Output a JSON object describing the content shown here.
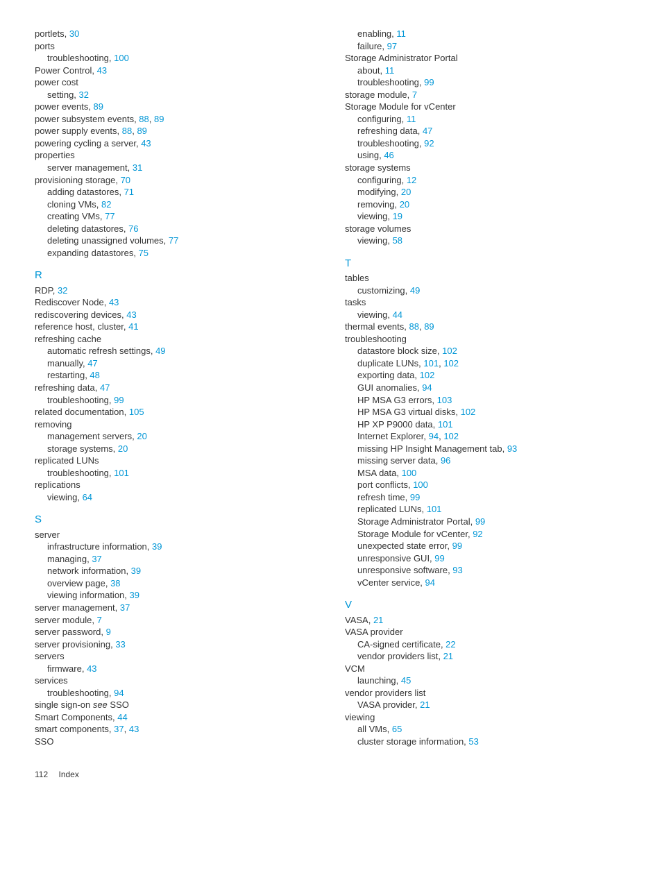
{
  "footer": {
    "pageNum": "112",
    "section": "Index"
  },
  "col1": [
    {
      "t": "line",
      "parts": [
        "portlets, ",
        {
          "p": "30"
        }
      ]
    },
    {
      "t": "line",
      "parts": [
        "ports"
      ]
    },
    {
      "t": "sub",
      "parts": [
        "troubleshooting, ",
        {
          "p": "100"
        }
      ]
    },
    {
      "t": "line",
      "parts": [
        "Power Control, ",
        {
          "p": "43"
        }
      ]
    },
    {
      "t": "line",
      "parts": [
        "power cost"
      ]
    },
    {
      "t": "sub",
      "parts": [
        "setting, ",
        {
          "p": "32"
        }
      ]
    },
    {
      "t": "line",
      "parts": [
        "power events, ",
        {
          "p": "89"
        }
      ]
    },
    {
      "t": "line",
      "parts": [
        "power subsystem events, ",
        {
          "p": "88"
        },
        ", ",
        {
          "p": "89"
        }
      ]
    },
    {
      "t": "line",
      "parts": [
        "power supply events, ",
        {
          "p": "88"
        },
        ", ",
        {
          "p": "89"
        }
      ]
    },
    {
      "t": "line",
      "parts": [
        "powering cycling a server, ",
        {
          "p": "43"
        }
      ]
    },
    {
      "t": "line",
      "parts": [
        "properties"
      ]
    },
    {
      "t": "sub",
      "parts": [
        "server management, ",
        {
          "p": "31"
        }
      ]
    },
    {
      "t": "line",
      "parts": [
        "provisioning storage, ",
        {
          "p": "70"
        }
      ]
    },
    {
      "t": "sub",
      "parts": [
        "adding datastores, ",
        {
          "p": "71"
        }
      ]
    },
    {
      "t": "sub",
      "parts": [
        "cloning VMs, ",
        {
          "p": "82"
        }
      ]
    },
    {
      "t": "sub",
      "parts": [
        "creating VMs, ",
        {
          "p": "77"
        }
      ]
    },
    {
      "t": "sub",
      "parts": [
        "deleting datastores, ",
        {
          "p": "76"
        }
      ]
    },
    {
      "t": "sub",
      "parts": [
        "deleting unassigned volumes, ",
        {
          "p": "77"
        }
      ]
    },
    {
      "t": "sub",
      "parts": [
        "expanding datastores, ",
        {
          "p": "75"
        }
      ]
    },
    {
      "t": "letter",
      "label": "R"
    },
    {
      "t": "line",
      "parts": [
        "RDP, ",
        {
          "p": "32"
        }
      ]
    },
    {
      "t": "line",
      "parts": [
        "Rediscover Node, ",
        {
          "p": "43"
        }
      ]
    },
    {
      "t": "line",
      "parts": [
        "rediscovering devices, ",
        {
          "p": "43"
        }
      ]
    },
    {
      "t": "line",
      "parts": [
        "reference host, cluster, ",
        {
          "p": "41"
        }
      ]
    },
    {
      "t": "line",
      "parts": [
        "refreshing cache"
      ]
    },
    {
      "t": "sub",
      "parts": [
        "automatic refresh settings, ",
        {
          "p": "49"
        }
      ]
    },
    {
      "t": "sub",
      "parts": [
        "manually, ",
        {
          "p": "47"
        }
      ]
    },
    {
      "t": "sub",
      "parts": [
        "restarting, ",
        {
          "p": "48"
        }
      ]
    },
    {
      "t": "line",
      "parts": [
        "refreshing data, ",
        {
          "p": "47"
        }
      ]
    },
    {
      "t": "sub",
      "parts": [
        "troubleshooting, ",
        {
          "p": "99"
        }
      ]
    },
    {
      "t": "line",
      "parts": [
        "related documentation, ",
        {
          "p": "105"
        }
      ]
    },
    {
      "t": "line",
      "parts": [
        "removing"
      ]
    },
    {
      "t": "sub",
      "parts": [
        "management servers, ",
        {
          "p": "20"
        }
      ]
    },
    {
      "t": "sub",
      "parts": [
        "storage systems, ",
        {
          "p": "20"
        }
      ]
    },
    {
      "t": "line",
      "parts": [
        "replicated LUNs"
      ]
    },
    {
      "t": "sub",
      "parts": [
        "troubleshooting, ",
        {
          "p": "101"
        }
      ]
    },
    {
      "t": "line",
      "parts": [
        "replications"
      ]
    },
    {
      "t": "sub",
      "parts": [
        "viewing, ",
        {
          "p": "64"
        }
      ]
    },
    {
      "t": "letter",
      "label": "S"
    },
    {
      "t": "line",
      "parts": [
        "server"
      ]
    },
    {
      "t": "sub",
      "parts": [
        "infrastructure information, ",
        {
          "p": "39"
        }
      ]
    },
    {
      "t": "sub",
      "parts": [
        "managing, ",
        {
          "p": "37"
        }
      ]
    },
    {
      "t": "sub",
      "parts": [
        "network information, ",
        {
          "p": "39"
        }
      ]
    },
    {
      "t": "sub",
      "parts": [
        "overview page, ",
        {
          "p": "38"
        }
      ]
    },
    {
      "t": "sub",
      "parts": [
        "viewing information, ",
        {
          "p": "39"
        }
      ]
    },
    {
      "t": "line",
      "parts": [
        "server management, ",
        {
          "p": "37"
        }
      ]
    },
    {
      "t": "line",
      "parts": [
        "server module, ",
        {
          "p": "7"
        }
      ]
    },
    {
      "t": "line",
      "parts": [
        "server password, ",
        {
          "p": "9"
        }
      ]
    },
    {
      "t": "line",
      "parts": [
        "server provisioning, ",
        {
          "p": "33"
        }
      ]
    },
    {
      "t": "line",
      "parts": [
        "servers"
      ]
    },
    {
      "t": "sub",
      "parts": [
        "firmware, ",
        {
          "p": "43"
        }
      ]
    },
    {
      "t": "line",
      "parts": [
        "services"
      ]
    },
    {
      "t": "sub",
      "parts": [
        "troubleshooting, ",
        {
          "p": "94"
        }
      ]
    },
    {
      "t": "line",
      "parts": [
        "single sign-on ",
        {
          "i": "see"
        },
        " SSO"
      ]
    },
    {
      "t": "line",
      "parts": [
        "Smart Components, ",
        {
          "p": "44"
        }
      ]
    },
    {
      "t": "line",
      "parts": [
        "smart components, ",
        {
          "p": "37"
        },
        ", ",
        {
          "p": "43"
        }
      ]
    },
    {
      "t": "line",
      "parts": [
        "SSO"
      ]
    }
  ],
  "col2": [
    {
      "t": "sub",
      "parts": [
        "enabling, ",
        {
          "p": "11"
        }
      ]
    },
    {
      "t": "sub",
      "parts": [
        "failure, ",
        {
          "p": "97"
        }
      ]
    },
    {
      "t": "line",
      "parts": [
        "Storage Administrator Portal"
      ]
    },
    {
      "t": "sub",
      "parts": [
        "about, ",
        {
          "p": "11"
        }
      ]
    },
    {
      "t": "sub",
      "parts": [
        "troubleshooting, ",
        {
          "p": "99"
        }
      ]
    },
    {
      "t": "line",
      "parts": [
        "storage module, ",
        {
          "p": "7"
        }
      ]
    },
    {
      "t": "line",
      "parts": [
        "Storage Module for vCenter"
      ]
    },
    {
      "t": "sub",
      "parts": [
        "configuring, ",
        {
          "p": "11"
        }
      ]
    },
    {
      "t": "sub",
      "parts": [
        "refreshing data, ",
        {
          "p": "47"
        }
      ]
    },
    {
      "t": "sub",
      "parts": [
        "troubleshooting, ",
        {
          "p": "92"
        }
      ]
    },
    {
      "t": "sub",
      "parts": [
        "using, ",
        {
          "p": "46"
        }
      ]
    },
    {
      "t": "line",
      "parts": [
        "storage systems"
      ]
    },
    {
      "t": "sub",
      "parts": [
        "configuring, ",
        {
          "p": "12"
        }
      ]
    },
    {
      "t": "sub",
      "parts": [
        "modifying, ",
        {
          "p": "20"
        }
      ]
    },
    {
      "t": "sub",
      "parts": [
        "removing, ",
        {
          "p": "20"
        }
      ]
    },
    {
      "t": "sub",
      "parts": [
        "viewing, ",
        {
          "p": "19"
        }
      ]
    },
    {
      "t": "line",
      "parts": [
        "storage volumes"
      ]
    },
    {
      "t": "sub",
      "parts": [
        "viewing, ",
        {
          "p": "58"
        }
      ]
    },
    {
      "t": "letter",
      "label": "T"
    },
    {
      "t": "line",
      "parts": [
        "tables"
      ]
    },
    {
      "t": "sub",
      "parts": [
        "customizing, ",
        {
          "p": "49"
        }
      ]
    },
    {
      "t": "line",
      "parts": [
        "tasks"
      ]
    },
    {
      "t": "sub",
      "parts": [
        "viewing, ",
        {
          "p": "44"
        }
      ]
    },
    {
      "t": "line",
      "parts": [
        "thermal events, ",
        {
          "p": "88"
        },
        ", ",
        {
          "p": "89"
        }
      ]
    },
    {
      "t": "line",
      "parts": [
        "troubleshooting"
      ]
    },
    {
      "t": "sub",
      "parts": [
        "datastore block size, ",
        {
          "p": "102"
        }
      ]
    },
    {
      "t": "sub",
      "parts": [
        "duplicate LUNs, ",
        {
          "p": "101"
        },
        ", ",
        {
          "p": "102"
        }
      ]
    },
    {
      "t": "sub",
      "parts": [
        "exporting data, ",
        {
          "p": "102"
        }
      ]
    },
    {
      "t": "sub",
      "parts": [
        "GUI anomalies, ",
        {
          "p": "94"
        }
      ]
    },
    {
      "t": "sub",
      "parts": [
        "HP MSA G3 errors, ",
        {
          "p": "103"
        }
      ]
    },
    {
      "t": "sub",
      "parts": [
        "HP MSA G3 virtual disks, ",
        {
          "p": "102"
        }
      ]
    },
    {
      "t": "sub",
      "parts": [
        "HP XP P9000 data, ",
        {
          "p": "101"
        }
      ]
    },
    {
      "t": "sub",
      "parts": [
        "Internet Explorer, ",
        {
          "p": "94"
        },
        ", ",
        {
          "p": "102"
        }
      ]
    },
    {
      "t": "sub",
      "parts": [
        "missing HP Insight Management tab, ",
        {
          "p": "93"
        }
      ]
    },
    {
      "t": "sub",
      "parts": [
        "missing server data, ",
        {
          "p": "96"
        }
      ]
    },
    {
      "t": "sub",
      "parts": [
        "MSA data, ",
        {
          "p": "100"
        }
      ]
    },
    {
      "t": "sub",
      "parts": [
        "port conflicts, ",
        {
          "p": "100"
        }
      ]
    },
    {
      "t": "sub",
      "parts": [
        "refresh time, ",
        {
          "p": "99"
        }
      ]
    },
    {
      "t": "sub",
      "parts": [
        "replicated LUNs, ",
        {
          "p": "101"
        }
      ]
    },
    {
      "t": "sub",
      "parts": [
        "Storage Administrator Portal, ",
        {
          "p": "99"
        }
      ]
    },
    {
      "t": "sub",
      "parts": [
        "Storage Module for vCenter, ",
        {
          "p": "92"
        }
      ]
    },
    {
      "t": "sub",
      "parts": [
        "unexpected state error, ",
        {
          "p": "99"
        }
      ]
    },
    {
      "t": "sub",
      "parts": [
        "unresponsive GUI, ",
        {
          "p": "99"
        }
      ]
    },
    {
      "t": "sub",
      "parts": [
        "unresponsive software, ",
        {
          "p": "93"
        }
      ]
    },
    {
      "t": "sub",
      "parts": [
        "vCenter service, ",
        {
          "p": "94"
        }
      ]
    },
    {
      "t": "letter",
      "label": "V"
    },
    {
      "t": "line",
      "parts": [
        "VASA, ",
        {
          "p": "21"
        }
      ]
    },
    {
      "t": "line",
      "parts": [
        "VASA provider"
      ]
    },
    {
      "t": "sub",
      "parts": [
        "CA-signed certificate, ",
        {
          "p": "22"
        }
      ]
    },
    {
      "t": "sub",
      "parts": [
        "vendor providers list, ",
        {
          "p": "21"
        }
      ]
    },
    {
      "t": "line",
      "parts": [
        "VCM"
      ]
    },
    {
      "t": "sub",
      "parts": [
        "launching, ",
        {
          "p": "45"
        }
      ]
    },
    {
      "t": "line",
      "parts": [
        "vendor providers list"
      ]
    },
    {
      "t": "sub",
      "parts": [
        "VASA provider, ",
        {
          "p": "21"
        }
      ]
    },
    {
      "t": "line",
      "parts": [
        "viewing"
      ]
    },
    {
      "t": "sub",
      "parts": [
        "all VMs, ",
        {
          "p": "65"
        }
      ]
    },
    {
      "t": "sub",
      "parts": [
        "cluster storage information, ",
        {
          "p": "53"
        }
      ]
    }
  ]
}
